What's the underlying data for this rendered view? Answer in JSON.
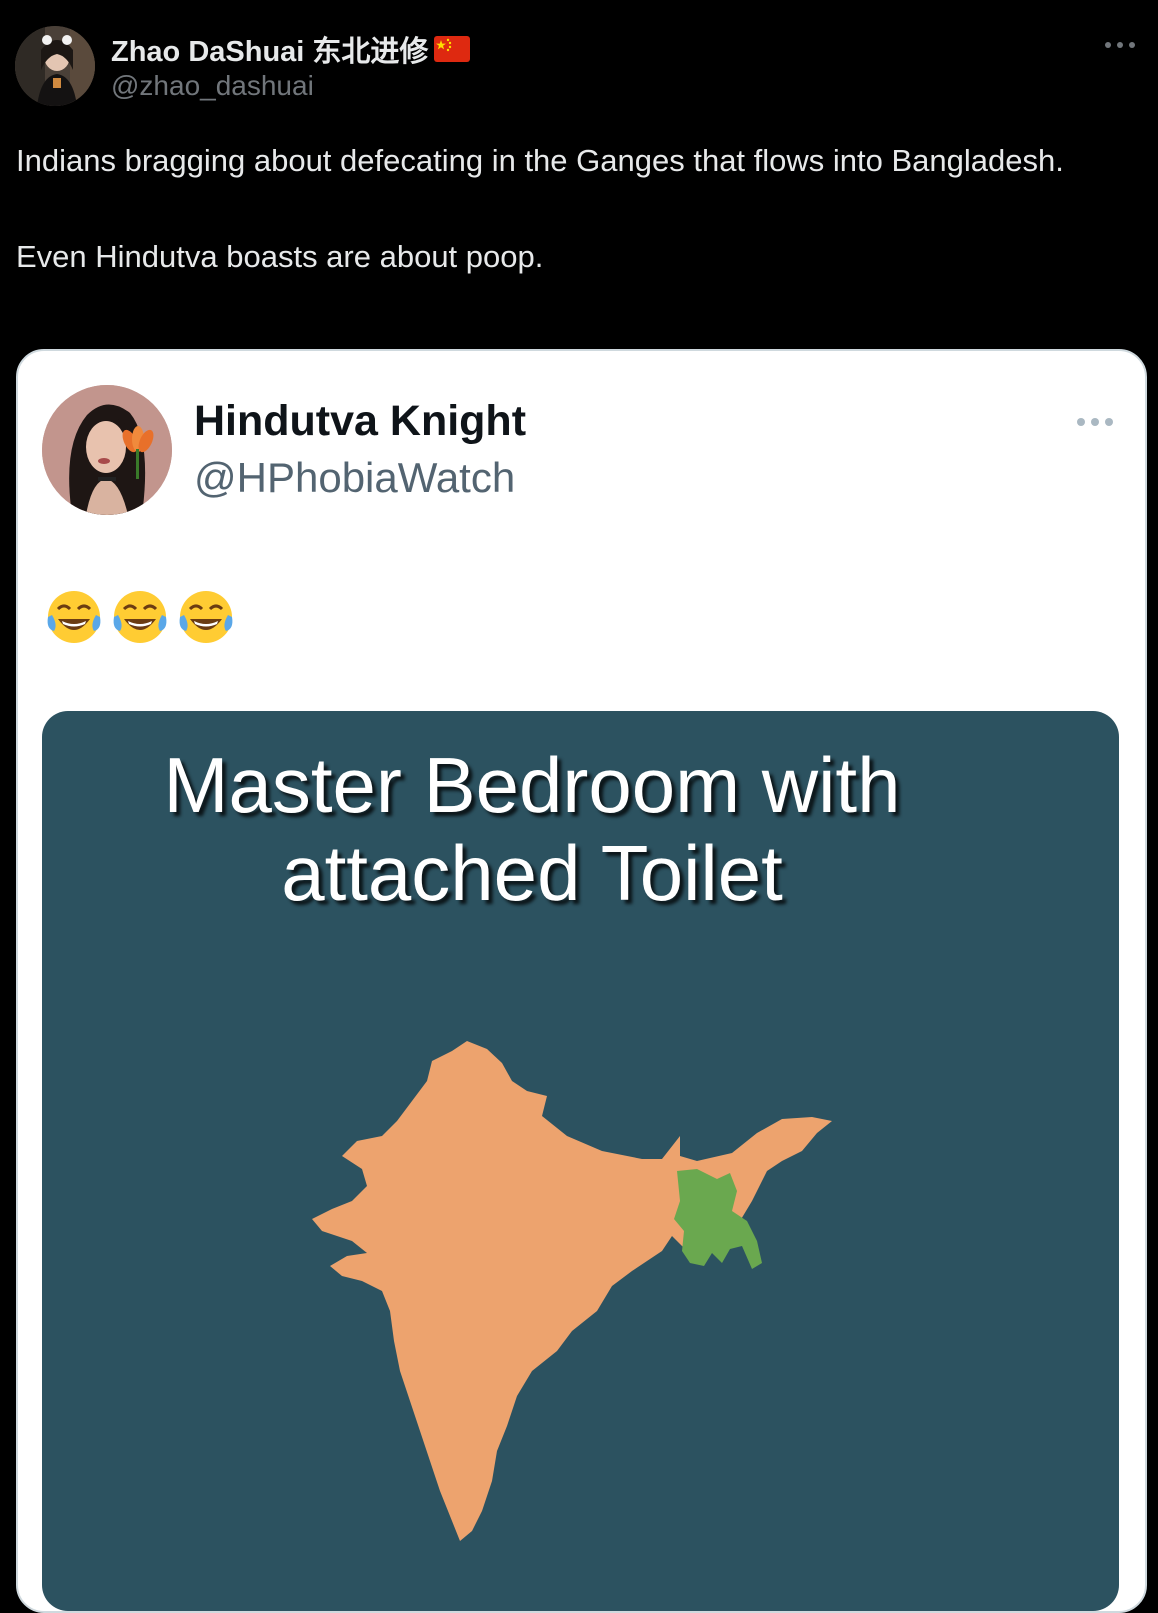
{
  "post": {
    "author": {
      "display_name": "Zhao DaShuai 东北进修",
      "handle": "@zhao_dashuai",
      "flag_icon": "china-flag-icon"
    },
    "text_lines": [
      "Indians bragging about defecating in the Ganges that flows into Bangladesh.",
      "Even Hindutva boasts are about poop."
    ],
    "more_icon": "more-dots-icon"
  },
  "quoted_post": {
    "author": {
      "display_name": "Hindutva Knight",
      "handle": "@HPhobiaWatch"
    },
    "emoji_text": "😂😂😂",
    "media": {
      "caption_line1": "Master Bedroom with",
      "caption_line2": "attached Toilet",
      "background_color": "#2c5260",
      "india_color": "#eda36e",
      "bangladesh_color": "#6aa84f"
    }
  },
  "theme": {
    "background": "#000000",
    "text_primary": "#e7e9ea",
    "text_secondary": "#71767b",
    "card_background": "#ffffff",
    "card_text": "#0f1419",
    "card_secondary": "#536471"
  }
}
